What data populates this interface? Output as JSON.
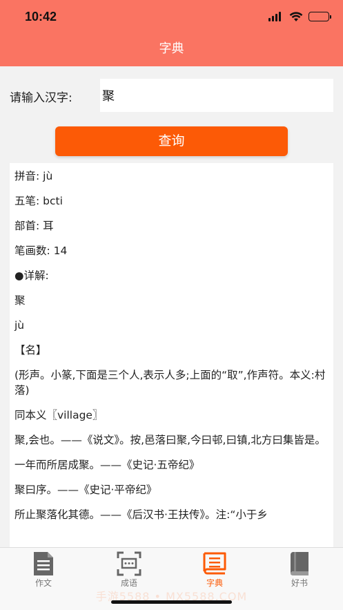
{
  "status_bar": {
    "time": "10:42"
  },
  "nav": {
    "title": "字典"
  },
  "search": {
    "label": "请输入汉字:",
    "value": "聚",
    "button_label": "查询"
  },
  "result": {
    "lines": [
      "拼音: jù",
      "五笔: bcti",
      "部首: 耳",
      "笔画数: 14",
      "●详解:",
      "聚",
      "jù",
      "【名】",
      "(形声。小篆,下面是三个人,表示人多;上面的“取”,作声符。本义:村落)",
      "同本义〖village〗",
      "聚,会也。——《说文》。按,邑落曰聚,今曰邨,曰镇,北方曰集皆是。",
      "一年而所居成聚。——《史记·五帝纪》",
      "聚曰序。——《史记·平帝纪》",
      "所止聚落化其德。——《后汉书·王扶传》。注:“小于乡"
    ]
  },
  "tabbar": {
    "tabs": [
      {
        "label": "作文",
        "icon": "document-icon",
        "active": false
      },
      {
        "label": "成语",
        "icon": "scan-text-icon",
        "active": false
      },
      {
        "label": "字典",
        "icon": "dictionary-icon",
        "active": true
      },
      {
        "label": "好书",
        "icon": "book-icon",
        "active": false
      }
    ]
  },
  "watermark": {
    "text": "手游5588 • MX5588.COM"
  },
  "colors": {
    "header": "#fa7462",
    "accent": "#fc5a06",
    "background": "#f2f2f2"
  }
}
